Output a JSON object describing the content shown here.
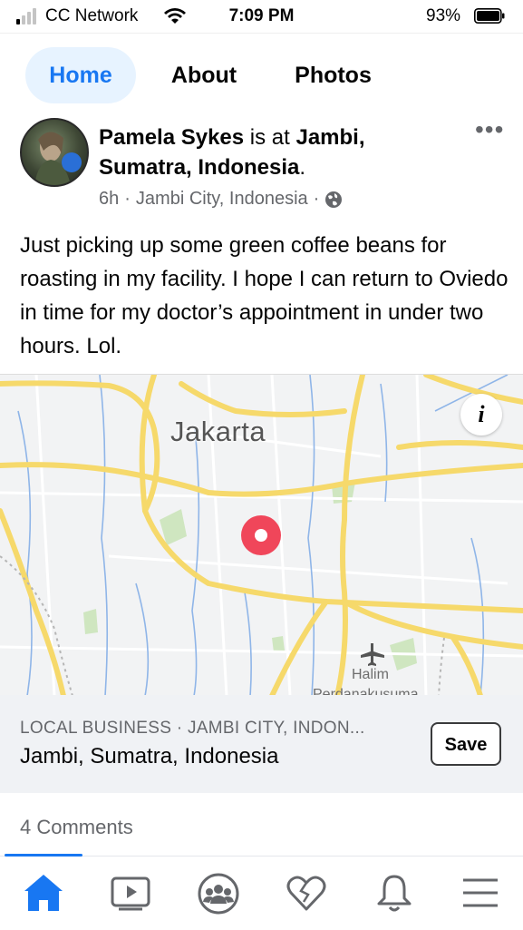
{
  "status_bar": {
    "carrier": "CC Network",
    "time": "7:09 PM",
    "battery": "93%"
  },
  "tabs": [
    {
      "label": "Home",
      "active": true
    },
    {
      "label": "About",
      "active": false
    },
    {
      "label": "Photos",
      "active": false
    }
  ],
  "post": {
    "author": "Pamela Sykes",
    "is_at": "is at",
    "place": "Jambi, Sumatra, Indonesia",
    "period": ".",
    "time_ago": "6h",
    "location": "Jambi City, Indonesia",
    "sep": "·",
    "privacy_icon": "globe-icon",
    "more_icon": "more-horizontal-icon",
    "more_glyph": "•••",
    "text": "Just picking up some green coffee beans for roasting in my facility. I hope I can return to Oviedo in time for my doctor’s appointment in under two hours. Lol."
  },
  "map": {
    "city_label": "Jakarta",
    "airport_label": "Halim",
    "airport_label_2": "Perdanakusuma",
    "info_glyph": "i",
    "pin_color": "#f0465a",
    "road_color": "#f6d96b"
  },
  "place_card": {
    "category": "LOCAL BUSINESS · JAMBI CITY, INDON...",
    "name": "Jambi, Sumatra, Indonesia",
    "save_label": "Save"
  },
  "comments": {
    "label": "4 Comments"
  },
  "bottom_nav": [
    {
      "icon": "home-icon",
      "active": true
    },
    {
      "icon": "video-icon",
      "active": false
    },
    {
      "icon": "groups-icon",
      "active": false
    },
    {
      "icon": "dating-heart-icon",
      "active": false
    },
    {
      "icon": "bell-icon",
      "active": false
    },
    {
      "icon": "menu-icon",
      "active": false
    }
  ],
  "colors": {
    "accent": "#1877f2",
    "tab_active_bg": "#e7f3ff",
    "secondary_text": "#65676b"
  }
}
